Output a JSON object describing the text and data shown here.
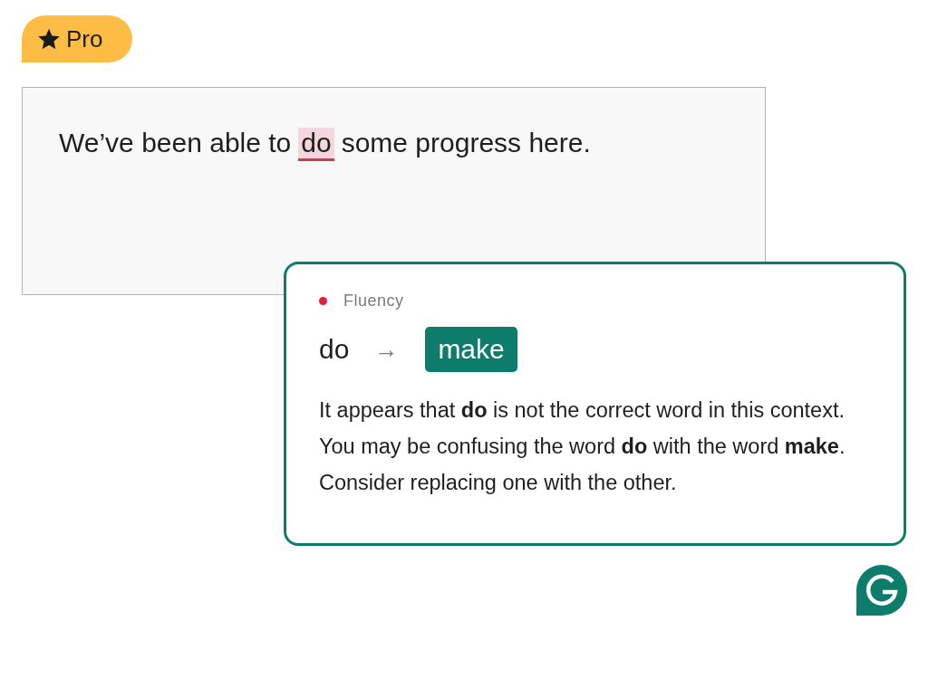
{
  "badge": {
    "label": "Pro"
  },
  "editor": {
    "segments": [
      {
        "text": "We’ve been able to",
        "flagged": false
      },
      {
        "text": "do",
        "flagged": true
      },
      {
        "text": "some progress here.",
        "flagged": false
      }
    ]
  },
  "suggestion_card": {
    "category": "Fluency",
    "original": "do",
    "arrow": "→",
    "replacement": "make",
    "explanation": "It appears that **do** is not the correct word in this context. You may be confusing the word **do** with the word **make**. Consider replacing one with the other."
  }
}
